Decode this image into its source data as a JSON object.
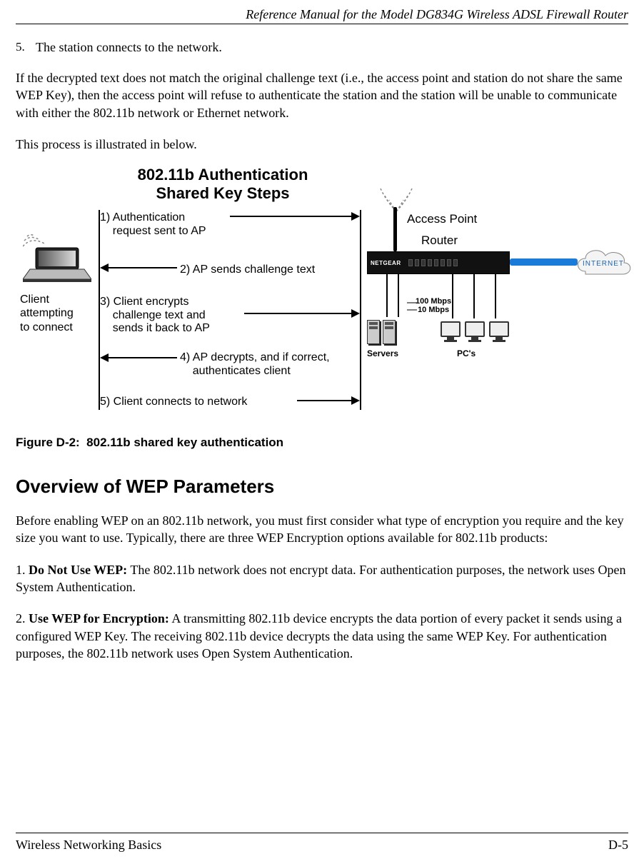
{
  "header": {
    "title": "Reference Manual for the Model DG834G Wireless ADSL Firewall Router"
  },
  "list": {
    "num": "5.",
    "text": "The station connects to the network."
  },
  "p1": "If the decrypted text does not match the original challenge text (i.e., the access point and station do not share the same WEP Key), then the access point will refuse to authenticate the station and the station will be unable to communicate with either the 802.11b network or Ethernet network.",
  "p2": "This process is illustrated in below.",
  "figure": {
    "title_line1": "802.11b Authentication",
    "title_line2": "Shared Key Steps",
    "client_line1": "Client",
    "client_line2": "attempting",
    "client_line3": "to connect",
    "ap": "Access Point",
    "router": "Router",
    "router_brand": "NETGEAR",
    "internet": "INTERNET",
    "speed_line1": "100 Mbps",
    "speed_line2": "10 Mbps",
    "servers": "Servers",
    "pcs": "PC's",
    "step1_l1": "1) Authentication",
    "step1_l2": "    request sent to AP",
    "step2": "2) AP sends challenge text",
    "step3_l1": "3) Client encrypts",
    "step3_l2": "    challenge text and",
    "step3_l3": "    sends it back to AP",
    "step4_l1": "4) AP decrypts, and if correct,",
    "step4_l2": "    authenticates client",
    "step5": "5) Client connects to network",
    "caption": "Figure D-2:  802.11b shared key authentication"
  },
  "section_heading": "Overview of WEP Parameters",
  "p3": "Before enabling WEP on an 802.11b network, you must first consider what type of encryption you require and the key size you want to use. Typically, there are three WEP Encryption options available for 802.11b products:",
  "p4_prefix": "1. ",
  "p4_bold": "Do Not Use WEP:",
  "p4_rest": " The 802.11b network does not encrypt data. For authentication purposes, the network uses Open System Authentication.",
  "p5_prefix": "2. ",
  "p5_bold": "Use WEP for Encryption:",
  "p5_rest": " A transmitting 802.11b device encrypts the data portion of every packet it sends using a configured WEP Key. The receiving 802.11b device decrypts the data using the same WEP Key. For authentication purposes, the 802.11b network uses Open System Authentication.",
  "footer": {
    "left": "Wireless Networking Basics",
    "right": "D-5"
  }
}
